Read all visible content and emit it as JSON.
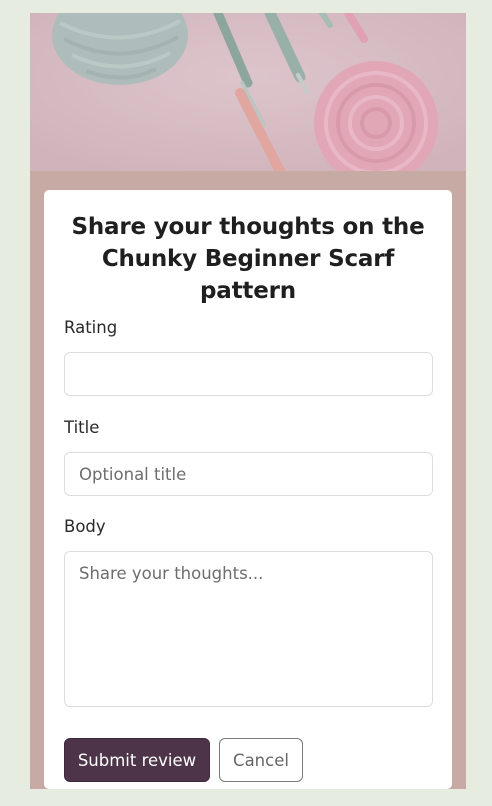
{
  "hero": {
    "image_description": "yarn-and-crochet-hooks"
  },
  "form": {
    "title": "Share your thoughts on the Chunky Beginner Scarf pattern",
    "rating": {
      "label": "Rating",
      "value": ""
    },
    "title_field": {
      "label": "Title",
      "placeholder": "Optional title",
      "value": ""
    },
    "body": {
      "label": "Body",
      "placeholder": "Share your thoughts...",
      "value": ""
    },
    "submit_label": "Submit review",
    "cancel_label": "Cancel"
  },
  "colors": {
    "page_bg": "#e6ece0",
    "frame_bg": "#c8aaa4",
    "primary_button": "#4d3449"
  }
}
